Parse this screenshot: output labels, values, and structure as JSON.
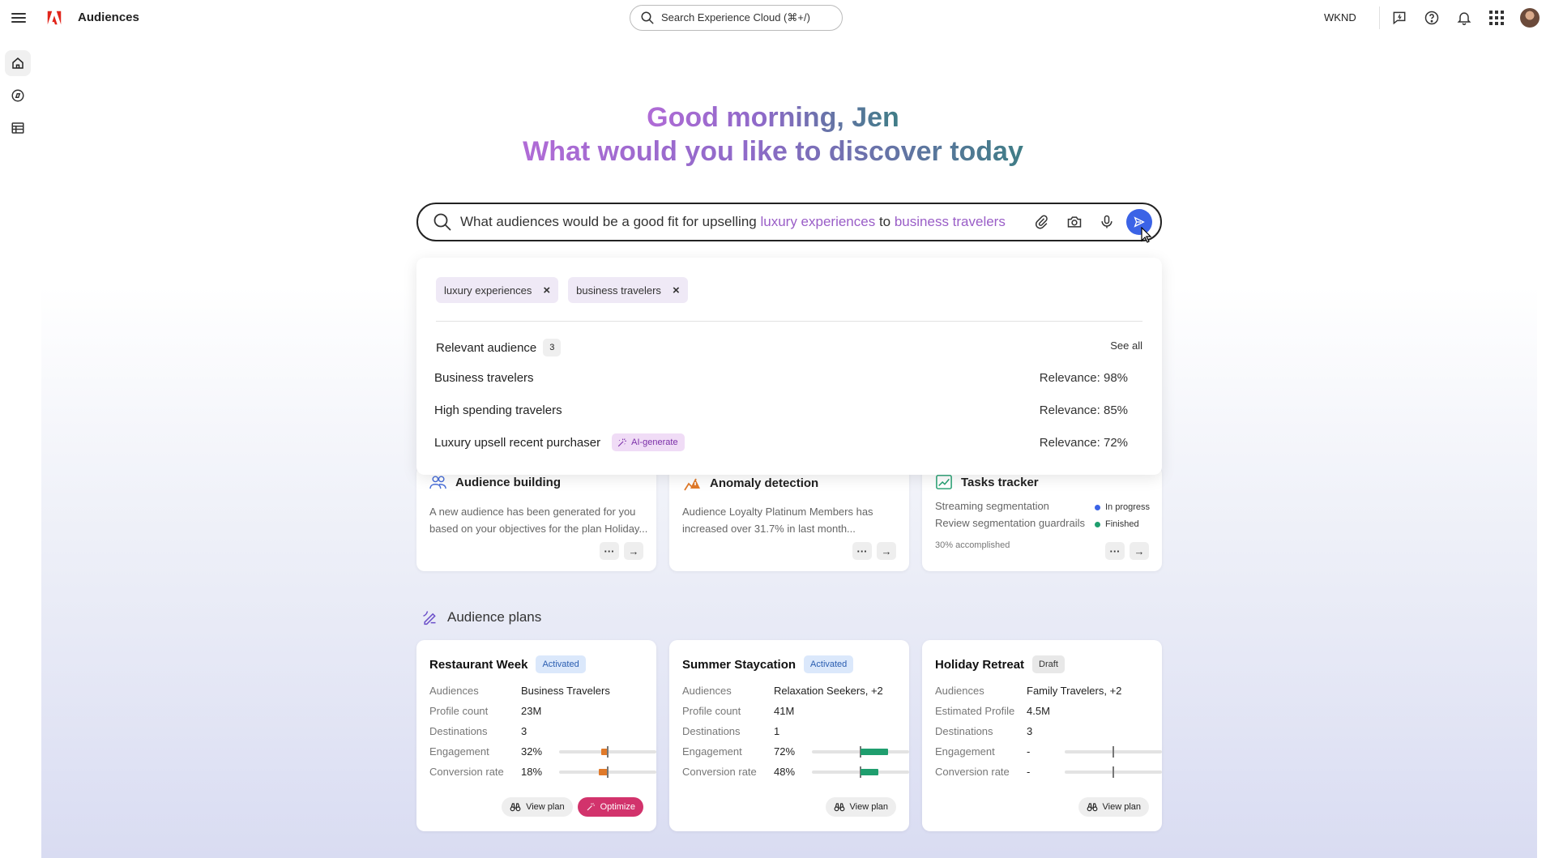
{
  "header": {
    "app_title": "Audiences",
    "search_placeholder": "Search Experience Cloud (⌘+/)",
    "org": "WKND"
  },
  "greeting": {
    "line1": "Good morning, Jen",
    "line2": "What would you like to discover today"
  },
  "prompt": {
    "text_before": "What audiences would be a good fit for upselling ",
    "highlight1": "luxury experiences",
    "text_mid": " to ",
    "highlight2": "business travelers"
  },
  "suggestions": {
    "chips": [
      "luxury experiences",
      "business travelers"
    ],
    "relevant_title": "Relevant audience",
    "relevant_count": "3",
    "see_all": "See all",
    "items": [
      {
        "name": "Business travelers",
        "relevance": "Relevance:  98%"
      },
      {
        "name": "High spending travelers",
        "relevance": "Relevance:  85%"
      },
      {
        "name": "Luxury upsell recent purchaser",
        "badge": "AI-generate",
        "relevance": "Relevance: 72%"
      }
    ]
  },
  "info_cards": {
    "audience_building": {
      "title": "Audience building",
      "desc": "A new audience has been generated for you based on your objectives for the plan Holiday..."
    },
    "anomaly": {
      "title": "Anomaly detection",
      "desc": "Audience Loyalty Platinum Members has increased over 31.7% in last month..."
    },
    "tasks": {
      "title": "Tasks tracker",
      "task1": "Streaming segmentation",
      "task1_status": "In progress",
      "task2": "Review segmentation guardrails",
      "task2_status": "Finished",
      "accomplished": "30% accomplished"
    }
  },
  "plans": {
    "section_title": "Audience plans",
    "view_plan": "View plan",
    "optimize": "Optimize",
    "cards": [
      {
        "name": "Restaurant Week",
        "status": "Activated",
        "rows": [
          {
            "label": "Audiences",
            "value": "Business Travelers"
          },
          {
            "label": "Profile count",
            "value": "23M"
          },
          {
            "label": "Destinations",
            "value": "3"
          },
          {
            "label": "Engagement",
            "value": "32%"
          },
          {
            "label": "Conversion rate",
            "value": "18%"
          }
        ]
      },
      {
        "name": "Summer Staycation",
        "status": "Activated",
        "rows": [
          {
            "label": "Audiences",
            "value": "Relaxation Seekers, +2"
          },
          {
            "label": "Profile count",
            "value": "41M"
          },
          {
            "label": "Destinations",
            "value": "1"
          },
          {
            "label": "Engagement",
            "value": "72%"
          },
          {
            "label": "Conversion rate",
            "value": "48%"
          }
        ]
      },
      {
        "name": "Holiday Retreat",
        "status": "Draft",
        "rows": [
          {
            "label": "Audiences",
            "value": "Family Travelers, +2"
          },
          {
            "label": "Estimated Profile",
            "value": "4.5M"
          },
          {
            "label": "Destinations",
            "value": "3"
          },
          {
            "label": "Engagement",
            "value": "-"
          },
          {
            "label": "Conversion rate",
            "value": "-"
          }
        ]
      }
    ]
  },
  "colors": {
    "accent_blue": "#3b63e6",
    "highlight_purple": "#9a5ec7",
    "below_avg_orange": "#e07a2a",
    "above_avg_green": "#1f9e6e",
    "optimize_pink": "#d2336c"
  }
}
